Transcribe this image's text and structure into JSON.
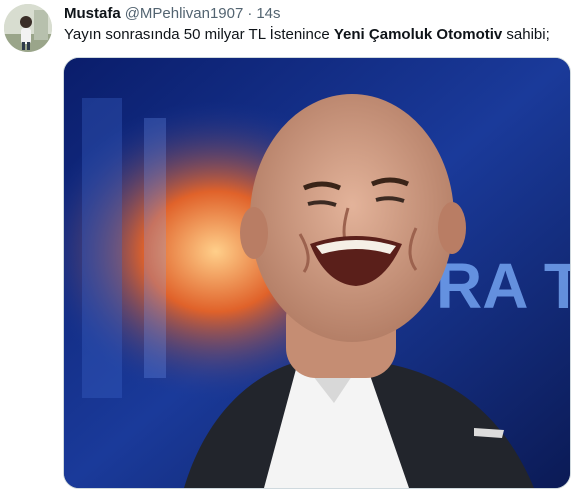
{
  "author": {
    "display_name": "Mustafa",
    "handle": "@MPehlivan1907",
    "separator": "·",
    "time": "14s"
  },
  "tweet": {
    "text_before": "Yayın sonrasında 50 milyar TL İstenince ",
    "text_bold": "Yeni Çamoluk Otomotiv",
    "text_after": " sahibi;"
  },
  "media": {
    "kind": "video-still",
    "background_letters": "RA TE"
  },
  "colors": {
    "text_primary": "#0f1419",
    "text_secondary": "#536471",
    "media_border": "#cfd9de",
    "studio_blue": "#0d1a4a"
  }
}
